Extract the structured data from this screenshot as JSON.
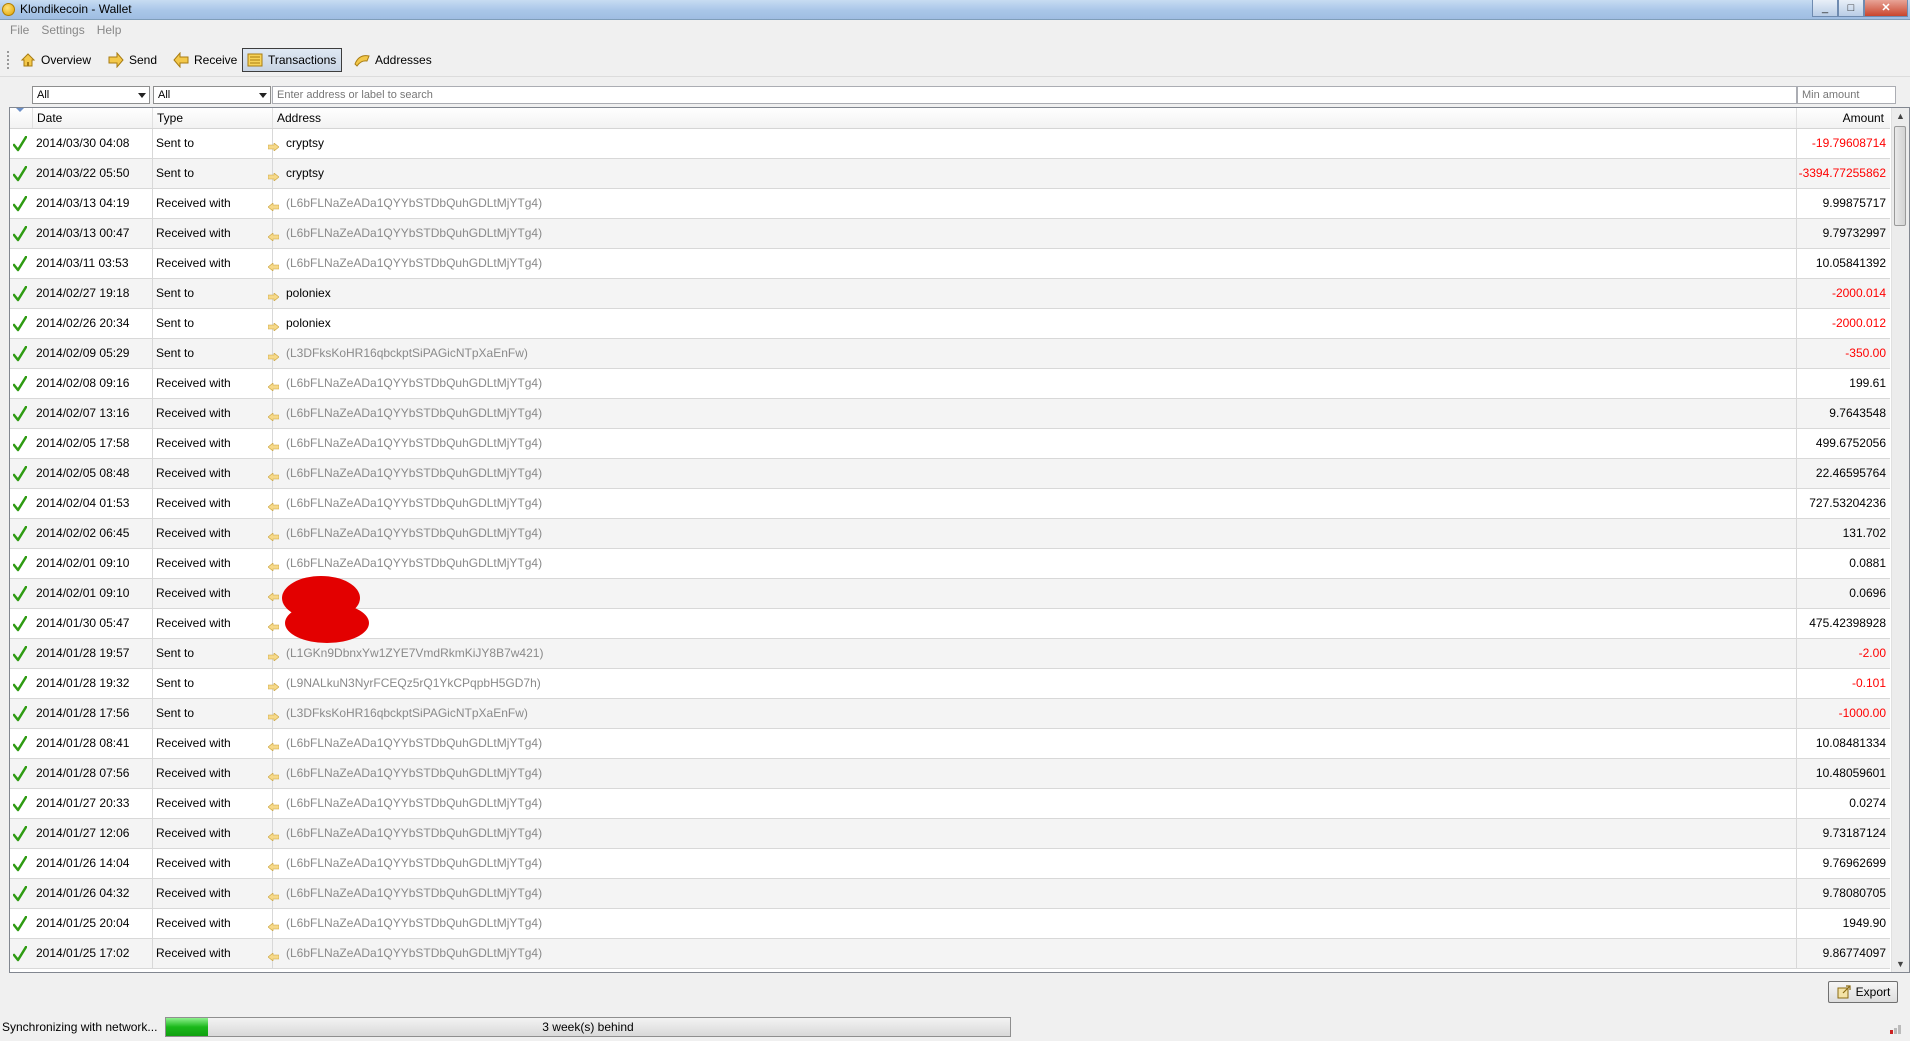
{
  "window": {
    "title": "Klondikecoin - Wallet"
  },
  "menu": [
    "File",
    "Settings",
    "Help"
  ],
  "toolbar": {
    "items": [
      {
        "label": "Overview",
        "icon": "home-icon"
      },
      {
        "label": "Send",
        "icon": "send-arrow-icon"
      },
      {
        "label": "Receive",
        "icon": "receive-arrow-icon"
      },
      {
        "label": "Transactions",
        "icon": "transactions-list-icon",
        "active": true
      },
      {
        "label": "Addresses",
        "icon": "address-book-icon"
      }
    ]
  },
  "filters": {
    "date_filter": "All",
    "type_filter": "All",
    "search_placeholder": "Enter address or label to search",
    "min_amount_placeholder": "Min amount"
  },
  "table": {
    "columns": {
      "date": "Date",
      "type": "Type",
      "address": "Address",
      "amount": "Amount"
    },
    "rows": [
      {
        "date": "2014/03/30 04:08",
        "type": "Sent to",
        "address": "cryptsy",
        "amount": "-19.79608714",
        "negative": true,
        "labeled": true
      },
      {
        "date": "2014/03/22 05:50",
        "type": "Sent to",
        "address": "cryptsy",
        "amount": "-3394.77255862",
        "negative": true,
        "labeled": true
      },
      {
        "date": "2014/03/13 04:19",
        "type": "Received with",
        "address": "(L6bFLNaZeADa1QYYbSTDbQuhGDLtMjYTg4)",
        "amount": "9.99875717"
      },
      {
        "date": "2014/03/13 00:47",
        "type": "Received with",
        "address": "(L6bFLNaZeADa1QYYbSTDbQuhGDLtMjYTg4)",
        "amount": "9.79732997"
      },
      {
        "date": "2014/03/11 03:53",
        "type": "Received with",
        "address": "(L6bFLNaZeADa1QYYbSTDbQuhGDLtMjYTg4)",
        "amount": "10.05841392"
      },
      {
        "date": "2014/02/27 19:18",
        "type": "Sent to",
        "address": "poloniex",
        "amount": "-2000.014",
        "negative": true,
        "labeled": true
      },
      {
        "date": "2014/02/26 20:34",
        "type": "Sent to",
        "address": "poloniex",
        "amount": "-2000.012",
        "negative": true,
        "labeled": true
      },
      {
        "date": "2014/02/09 05:29",
        "type": "Sent to",
        "address": "(L3DFksKoHR16qbckptSiPAGicNTpXaEnFw)",
        "amount": "-350.00",
        "negative": true
      },
      {
        "date": "2014/02/08 09:16",
        "type": "Received with",
        "address": "(L6bFLNaZeADa1QYYbSTDbQuhGDLtMjYTg4)",
        "amount": "199.61"
      },
      {
        "date": "2014/02/07 13:16",
        "type": "Received with",
        "address": "(L6bFLNaZeADa1QYYbSTDbQuhGDLtMjYTg4)",
        "amount": "9.7643548"
      },
      {
        "date": "2014/02/05 17:58",
        "type": "Received with",
        "address": "(L6bFLNaZeADa1QYYbSTDbQuhGDLtMjYTg4)",
        "amount": "499.6752056"
      },
      {
        "date": "2014/02/05 08:48",
        "type": "Received with",
        "address": "(L6bFLNaZeADa1QYYbSTDbQuhGDLtMjYTg4)",
        "amount": "22.46595764"
      },
      {
        "date": "2014/02/04 01:53",
        "type": "Received with",
        "address": "(L6bFLNaZeADa1QYYbSTDbQuhGDLtMjYTg4)",
        "amount": "727.53204236"
      },
      {
        "date": "2014/02/02 06:45",
        "type": "Received with",
        "address": "(L6bFLNaZeADa1QYYbSTDbQuhGDLtMjYTg4)",
        "amount": "131.702"
      },
      {
        "date": "2014/02/01 09:10",
        "type": "Received with",
        "address": "(L6bFLNaZeADa1QYYbSTDbQuhGDLtMjYTg4)",
        "amount": "0.0881"
      },
      {
        "date": "2014/02/01 09:10",
        "type": "Received with",
        "address": "",
        "amount": "0.0696"
      },
      {
        "date": "2014/01/30 05:47",
        "type": "Received with",
        "address": "",
        "amount": "475.42398928"
      },
      {
        "date": "2014/01/28 19:57",
        "type": "Sent to",
        "address": "(L1GKn9DbnxYw1ZYE7VmdRkmKiJY8B7w421)",
        "amount": "-2.00",
        "negative": true
      },
      {
        "date": "2014/01/28 19:32",
        "type": "Sent to",
        "address": "(L9NALkuN3NyrFCEQz5rQ1YkCPqpbH5GD7h)",
        "amount": "-0.101",
        "negative": true
      },
      {
        "date": "2014/01/28 17:56",
        "type": "Sent to",
        "address": "(L3DFksKoHR16qbckptSiPAGicNTpXaEnFw)",
        "amount": "-1000.00",
        "negative": true
      },
      {
        "date": "2014/01/28 08:41",
        "type": "Received with",
        "address": "(L6bFLNaZeADa1QYYbSTDbQuhGDLtMjYTg4)",
        "amount": "10.08481334"
      },
      {
        "date": "2014/01/28 07:56",
        "type": "Received with",
        "address": "(L6bFLNaZeADa1QYYbSTDbQuhGDLtMjYTg4)",
        "amount": "10.48059601"
      },
      {
        "date": "2014/01/27 20:33",
        "type": "Received with",
        "address": "(L6bFLNaZeADa1QYYbSTDbQuhGDLtMjYTg4)",
        "amount": "0.0274"
      },
      {
        "date": "2014/01/27 12:06",
        "type": "Received with",
        "address": "(L6bFLNaZeADa1QYYbSTDbQuhGDLtMjYTg4)",
        "amount": "9.73187124"
      },
      {
        "date": "2014/01/26 14:04",
        "type": "Received with",
        "address": "(L6bFLNaZeADa1QYYbSTDbQuhGDLtMjYTg4)",
        "amount": "9.76962699"
      },
      {
        "date": "2014/01/26 04:32",
        "type": "Received with",
        "address": "(L6bFLNaZeADa1QYYbSTDbQuhGDLtMjYTg4)",
        "amount": "9.78080705"
      },
      {
        "date": "2014/01/25 20:04",
        "type": "Received with",
        "address": "(L6bFLNaZeADa1QYYbSTDbQuhGDLtMjYTg4)",
        "amount": "1949.90"
      },
      {
        "date": "2014/01/25 17:02",
        "type": "Received with",
        "address": "(L6bFLNaZeADa1QYYbSTDbQuhGDLtMjYTg4)",
        "amount": "9.86774097"
      }
    ]
  },
  "export_button": {
    "label": "Export"
  },
  "status": {
    "text": "Synchronizing with network...",
    "progress_label": "3 week(s) behind",
    "progress_fraction": 0.05
  },
  "colors": {
    "negative": "#ff0000",
    "confirmed": "#2e9b12",
    "progress": "#1bb81b",
    "redaction": "#e30000"
  }
}
